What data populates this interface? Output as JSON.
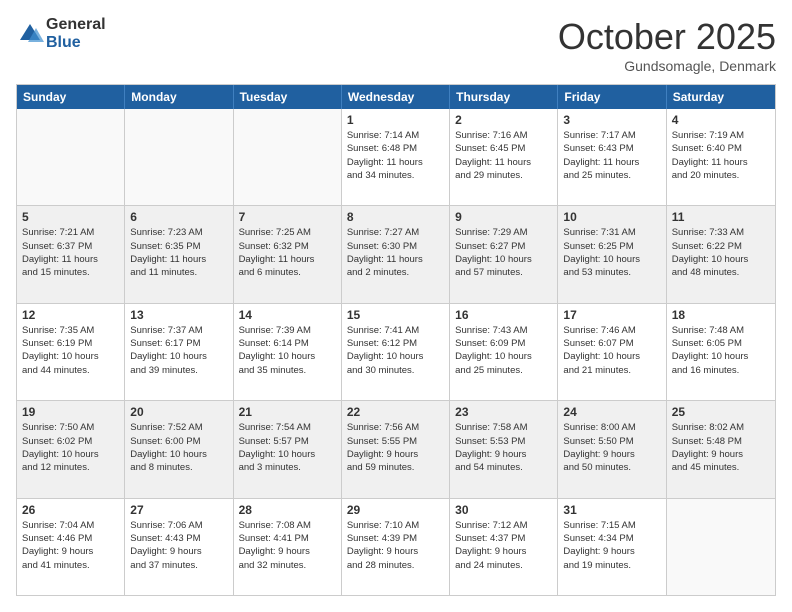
{
  "logo": {
    "general": "General",
    "blue": "Blue"
  },
  "title": "October 2025",
  "location": "Gundsomagle, Denmark",
  "dayHeaders": [
    "Sunday",
    "Monday",
    "Tuesday",
    "Wednesday",
    "Thursday",
    "Friday",
    "Saturday"
  ],
  "weeks": [
    [
      {
        "day": "",
        "info": ""
      },
      {
        "day": "",
        "info": ""
      },
      {
        "day": "",
        "info": ""
      },
      {
        "day": "1",
        "info": "Sunrise: 7:14 AM\nSunset: 6:48 PM\nDaylight: 11 hours\nand 34 minutes."
      },
      {
        "day": "2",
        "info": "Sunrise: 7:16 AM\nSunset: 6:45 PM\nDaylight: 11 hours\nand 29 minutes."
      },
      {
        "day": "3",
        "info": "Sunrise: 7:17 AM\nSunset: 6:43 PM\nDaylight: 11 hours\nand 25 minutes."
      },
      {
        "day": "4",
        "info": "Sunrise: 7:19 AM\nSunset: 6:40 PM\nDaylight: 11 hours\nand 20 minutes."
      }
    ],
    [
      {
        "day": "5",
        "info": "Sunrise: 7:21 AM\nSunset: 6:37 PM\nDaylight: 11 hours\nand 15 minutes."
      },
      {
        "day": "6",
        "info": "Sunrise: 7:23 AM\nSunset: 6:35 PM\nDaylight: 11 hours\nand 11 minutes."
      },
      {
        "day": "7",
        "info": "Sunrise: 7:25 AM\nSunset: 6:32 PM\nDaylight: 11 hours\nand 6 minutes."
      },
      {
        "day": "8",
        "info": "Sunrise: 7:27 AM\nSunset: 6:30 PM\nDaylight: 11 hours\nand 2 minutes."
      },
      {
        "day": "9",
        "info": "Sunrise: 7:29 AM\nSunset: 6:27 PM\nDaylight: 10 hours\nand 57 minutes."
      },
      {
        "day": "10",
        "info": "Sunrise: 7:31 AM\nSunset: 6:25 PM\nDaylight: 10 hours\nand 53 minutes."
      },
      {
        "day": "11",
        "info": "Sunrise: 7:33 AM\nSunset: 6:22 PM\nDaylight: 10 hours\nand 48 minutes."
      }
    ],
    [
      {
        "day": "12",
        "info": "Sunrise: 7:35 AM\nSunset: 6:19 PM\nDaylight: 10 hours\nand 44 minutes."
      },
      {
        "day": "13",
        "info": "Sunrise: 7:37 AM\nSunset: 6:17 PM\nDaylight: 10 hours\nand 39 minutes."
      },
      {
        "day": "14",
        "info": "Sunrise: 7:39 AM\nSunset: 6:14 PM\nDaylight: 10 hours\nand 35 minutes."
      },
      {
        "day": "15",
        "info": "Sunrise: 7:41 AM\nSunset: 6:12 PM\nDaylight: 10 hours\nand 30 minutes."
      },
      {
        "day": "16",
        "info": "Sunrise: 7:43 AM\nSunset: 6:09 PM\nDaylight: 10 hours\nand 25 minutes."
      },
      {
        "day": "17",
        "info": "Sunrise: 7:46 AM\nSunset: 6:07 PM\nDaylight: 10 hours\nand 21 minutes."
      },
      {
        "day": "18",
        "info": "Sunrise: 7:48 AM\nSunset: 6:05 PM\nDaylight: 10 hours\nand 16 minutes."
      }
    ],
    [
      {
        "day": "19",
        "info": "Sunrise: 7:50 AM\nSunset: 6:02 PM\nDaylight: 10 hours\nand 12 minutes."
      },
      {
        "day": "20",
        "info": "Sunrise: 7:52 AM\nSunset: 6:00 PM\nDaylight: 10 hours\nand 8 minutes."
      },
      {
        "day": "21",
        "info": "Sunrise: 7:54 AM\nSunset: 5:57 PM\nDaylight: 10 hours\nand 3 minutes."
      },
      {
        "day": "22",
        "info": "Sunrise: 7:56 AM\nSunset: 5:55 PM\nDaylight: 9 hours\nand 59 minutes."
      },
      {
        "day": "23",
        "info": "Sunrise: 7:58 AM\nSunset: 5:53 PM\nDaylight: 9 hours\nand 54 minutes."
      },
      {
        "day": "24",
        "info": "Sunrise: 8:00 AM\nSunset: 5:50 PM\nDaylight: 9 hours\nand 50 minutes."
      },
      {
        "day": "25",
        "info": "Sunrise: 8:02 AM\nSunset: 5:48 PM\nDaylight: 9 hours\nand 45 minutes."
      }
    ],
    [
      {
        "day": "26",
        "info": "Sunrise: 7:04 AM\nSunset: 4:46 PM\nDaylight: 9 hours\nand 41 minutes."
      },
      {
        "day": "27",
        "info": "Sunrise: 7:06 AM\nSunset: 4:43 PM\nDaylight: 9 hours\nand 37 minutes."
      },
      {
        "day": "28",
        "info": "Sunrise: 7:08 AM\nSunset: 4:41 PM\nDaylight: 9 hours\nand 32 minutes."
      },
      {
        "day": "29",
        "info": "Sunrise: 7:10 AM\nSunset: 4:39 PM\nDaylight: 9 hours\nand 28 minutes."
      },
      {
        "day": "30",
        "info": "Sunrise: 7:12 AM\nSunset: 4:37 PM\nDaylight: 9 hours\nand 24 minutes."
      },
      {
        "day": "31",
        "info": "Sunrise: 7:15 AM\nSunset: 4:34 PM\nDaylight: 9 hours\nand 19 minutes."
      },
      {
        "day": "",
        "info": ""
      }
    ]
  ]
}
